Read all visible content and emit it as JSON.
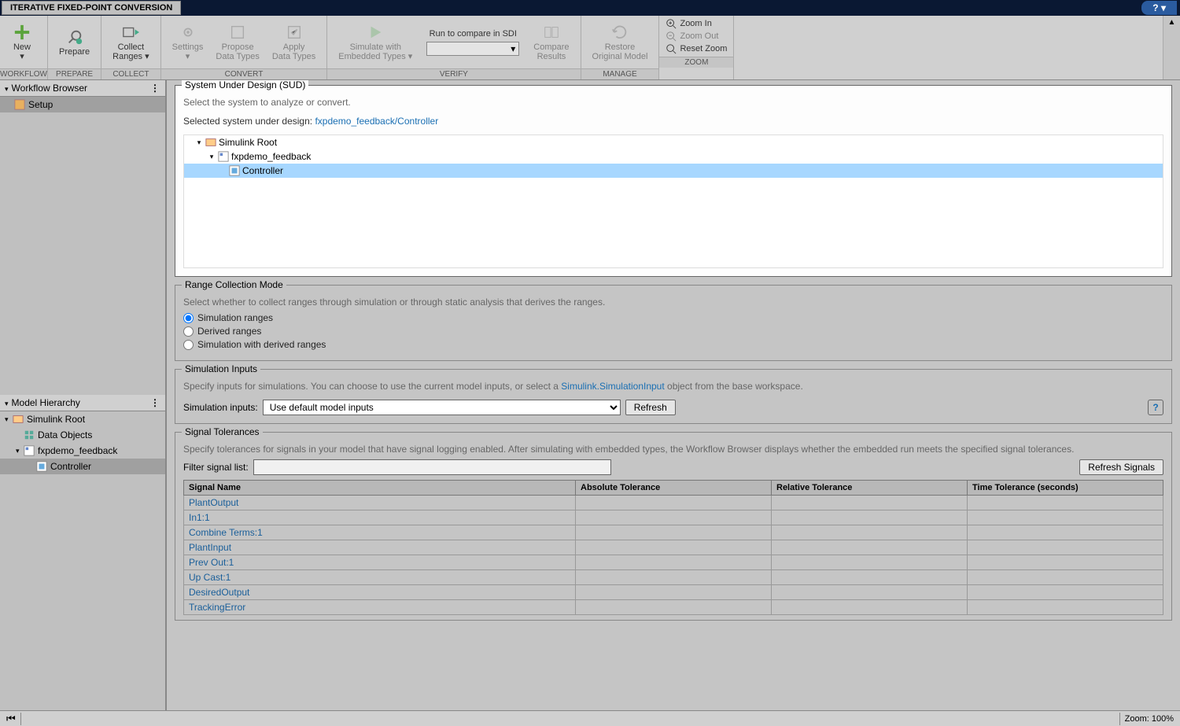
{
  "titlebar": {
    "tab": "ITERATIVE FIXED-POINT CONVERSION"
  },
  "ribbon": {
    "groups": {
      "workflow": {
        "label": "WORKFLOW",
        "new": "New"
      },
      "prepare": {
        "label": "PREPARE",
        "prepare": "Prepare"
      },
      "collect": {
        "label": "COLLECT",
        "collectRanges": "Collect\nRanges ▾"
      },
      "convert": {
        "label": "CONVERT",
        "settings": "Settings\n▾",
        "propose": "Propose\nData Types",
        "apply": "Apply\nData Types"
      },
      "verify": {
        "label": "VERIFY",
        "simulate": "Simulate with\nEmbedded Types ▾",
        "runCompare": "Run to compare in SDI",
        "compare": "Compare\nResults"
      },
      "manage": {
        "label": "MANAGE",
        "restore": "Restore\nOriginal Model"
      },
      "zoom": {
        "label": "ZOOM",
        "zoomIn": "Zoom In",
        "zoomOut": "Zoom Out",
        "resetZoom": "Reset Zoom"
      }
    }
  },
  "leftPanel": {
    "workflowBrowser": {
      "title": "Workflow Browser",
      "items": [
        "Setup"
      ]
    },
    "modelHierarchy": {
      "title": "Model Hierarchy",
      "root": "Simulink Root",
      "dataObjects": "Data Objects",
      "model": "fxpdemo_feedback",
      "controller": "Controller"
    }
  },
  "sud": {
    "legend": "System Under Design (SUD)",
    "info": "Select the system to analyze or convert.",
    "selectedLabel": "Selected system under design:",
    "selectedPath": "fxpdemo_feedback/Controller",
    "tree": {
      "root": "Simulink Root",
      "model": "fxpdemo_feedback",
      "controller": "Controller"
    }
  },
  "rangeMode": {
    "legend": "Range Collection Mode",
    "info": "Select whether to collect ranges through simulation or through static analysis that derives the ranges.",
    "options": [
      "Simulation ranges",
      "Derived ranges",
      "Simulation with derived ranges"
    ]
  },
  "simInputs": {
    "legend": "Simulation Inputs",
    "infoPrefix": "Specify inputs for simulations. You can choose to use the current model inputs, or select a ",
    "link": "Simulink.SimulationInput",
    "infoSuffix": " object from the base workspace.",
    "label": "Simulation inputs:",
    "selectValue": "Use default model inputs",
    "refresh": "Refresh"
  },
  "sigTol": {
    "legend": "Signal Tolerances",
    "info": "Specify tolerances for signals in your model that have signal logging enabled. After simulating with embedded types, the Workflow Browser displays whether the embedded run meets the specified signal tolerances.",
    "filterLabel": "Filter signal list:",
    "refresh": "Refresh Signals",
    "columns": [
      "Signal Name",
      "Absolute Tolerance",
      "Relative Tolerance",
      "Time Tolerance (seconds)"
    ],
    "signals": [
      {
        "name": "PlantOutput"
      },
      {
        "name": "In1:1"
      },
      {
        "name": "Combine Terms:1"
      },
      {
        "name": "PlantInput"
      },
      {
        "name": "Prev Out:1"
      },
      {
        "name": "Up Cast:1"
      },
      {
        "name": "DesiredOutput"
      },
      {
        "name": "TrackingError"
      }
    ]
  },
  "statusbar": {
    "zoom": "Zoom: 100%"
  }
}
